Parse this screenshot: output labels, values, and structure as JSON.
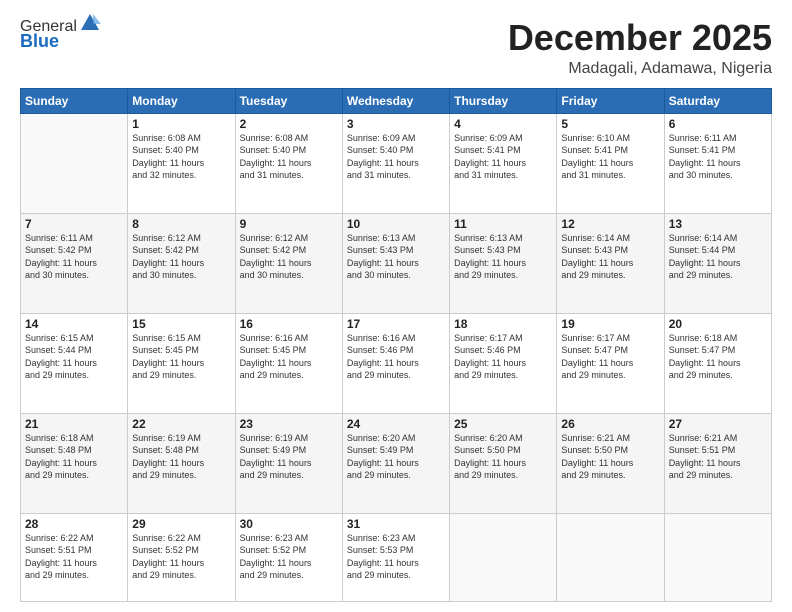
{
  "header": {
    "logo_general": "General",
    "logo_blue": "Blue",
    "month_title": "December 2025",
    "location": "Madagali, Adamawa, Nigeria"
  },
  "calendar": {
    "days_of_week": [
      "Sunday",
      "Monday",
      "Tuesday",
      "Wednesday",
      "Thursday",
      "Friday",
      "Saturday"
    ],
    "weeks": [
      [
        {
          "day": "",
          "info": ""
        },
        {
          "day": "1",
          "info": "Sunrise: 6:08 AM\nSunset: 5:40 PM\nDaylight: 11 hours\nand 32 minutes."
        },
        {
          "day": "2",
          "info": "Sunrise: 6:08 AM\nSunset: 5:40 PM\nDaylight: 11 hours\nand 31 minutes."
        },
        {
          "day": "3",
          "info": "Sunrise: 6:09 AM\nSunset: 5:40 PM\nDaylight: 11 hours\nand 31 minutes."
        },
        {
          "day": "4",
          "info": "Sunrise: 6:09 AM\nSunset: 5:41 PM\nDaylight: 11 hours\nand 31 minutes."
        },
        {
          "day": "5",
          "info": "Sunrise: 6:10 AM\nSunset: 5:41 PM\nDaylight: 11 hours\nand 31 minutes."
        },
        {
          "day": "6",
          "info": "Sunrise: 6:11 AM\nSunset: 5:41 PM\nDaylight: 11 hours\nand 30 minutes."
        }
      ],
      [
        {
          "day": "7",
          "info": "Sunrise: 6:11 AM\nSunset: 5:42 PM\nDaylight: 11 hours\nand 30 minutes."
        },
        {
          "day": "8",
          "info": "Sunrise: 6:12 AM\nSunset: 5:42 PM\nDaylight: 11 hours\nand 30 minutes."
        },
        {
          "day": "9",
          "info": "Sunrise: 6:12 AM\nSunset: 5:42 PM\nDaylight: 11 hours\nand 30 minutes."
        },
        {
          "day": "10",
          "info": "Sunrise: 6:13 AM\nSunset: 5:43 PM\nDaylight: 11 hours\nand 30 minutes."
        },
        {
          "day": "11",
          "info": "Sunrise: 6:13 AM\nSunset: 5:43 PM\nDaylight: 11 hours\nand 29 minutes."
        },
        {
          "day": "12",
          "info": "Sunrise: 6:14 AM\nSunset: 5:43 PM\nDaylight: 11 hours\nand 29 minutes."
        },
        {
          "day": "13",
          "info": "Sunrise: 6:14 AM\nSunset: 5:44 PM\nDaylight: 11 hours\nand 29 minutes."
        }
      ],
      [
        {
          "day": "14",
          "info": "Sunrise: 6:15 AM\nSunset: 5:44 PM\nDaylight: 11 hours\nand 29 minutes."
        },
        {
          "day": "15",
          "info": "Sunrise: 6:15 AM\nSunset: 5:45 PM\nDaylight: 11 hours\nand 29 minutes."
        },
        {
          "day": "16",
          "info": "Sunrise: 6:16 AM\nSunset: 5:45 PM\nDaylight: 11 hours\nand 29 minutes."
        },
        {
          "day": "17",
          "info": "Sunrise: 6:16 AM\nSunset: 5:46 PM\nDaylight: 11 hours\nand 29 minutes."
        },
        {
          "day": "18",
          "info": "Sunrise: 6:17 AM\nSunset: 5:46 PM\nDaylight: 11 hours\nand 29 minutes."
        },
        {
          "day": "19",
          "info": "Sunrise: 6:17 AM\nSunset: 5:47 PM\nDaylight: 11 hours\nand 29 minutes."
        },
        {
          "day": "20",
          "info": "Sunrise: 6:18 AM\nSunset: 5:47 PM\nDaylight: 11 hours\nand 29 minutes."
        }
      ],
      [
        {
          "day": "21",
          "info": "Sunrise: 6:18 AM\nSunset: 5:48 PM\nDaylight: 11 hours\nand 29 minutes."
        },
        {
          "day": "22",
          "info": "Sunrise: 6:19 AM\nSunset: 5:48 PM\nDaylight: 11 hours\nand 29 minutes."
        },
        {
          "day": "23",
          "info": "Sunrise: 6:19 AM\nSunset: 5:49 PM\nDaylight: 11 hours\nand 29 minutes."
        },
        {
          "day": "24",
          "info": "Sunrise: 6:20 AM\nSunset: 5:49 PM\nDaylight: 11 hours\nand 29 minutes."
        },
        {
          "day": "25",
          "info": "Sunrise: 6:20 AM\nSunset: 5:50 PM\nDaylight: 11 hours\nand 29 minutes."
        },
        {
          "day": "26",
          "info": "Sunrise: 6:21 AM\nSunset: 5:50 PM\nDaylight: 11 hours\nand 29 minutes."
        },
        {
          "day": "27",
          "info": "Sunrise: 6:21 AM\nSunset: 5:51 PM\nDaylight: 11 hours\nand 29 minutes."
        }
      ],
      [
        {
          "day": "28",
          "info": "Sunrise: 6:22 AM\nSunset: 5:51 PM\nDaylight: 11 hours\nand 29 minutes."
        },
        {
          "day": "29",
          "info": "Sunrise: 6:22 AM\nSunset: 5:52 PM\nDaylight: 11 hours\nand 29 minutes."
        },
        {
          "day": "30",
          "info": "Sunrise: 6:23 AM\nSunset: 5:52 PM\nDaylight: 11 hours\nand 29 minutes."
        },
        {
          "day": "31",
          "info": "Sunrise: 6:23 AM\nSunset: 5:53 PM\nDaylight: 11 hours\nand 29 minutes."
        },
        {
          "day": "",
          "info": ""
        },
        {
          "day": "",
          "info": ""
        },
        {
          "day": "",
          "info": ""
        }
      ]
    ]
  }
}
